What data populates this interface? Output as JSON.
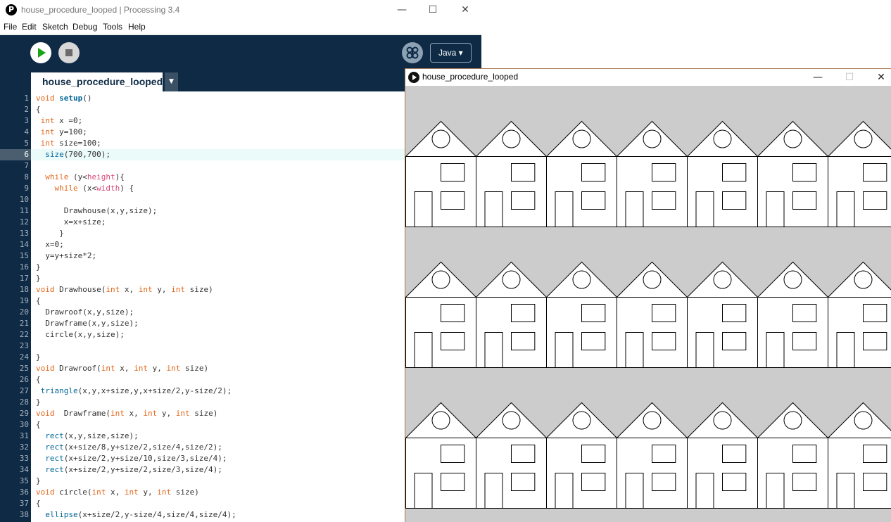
{
  "ide": {
    "window_title": "house_procedure_looped | Processing 3.4",
    "logo_glyph": "P",
    "window_controls": {
      "minimize": "—",
      "maximize": "☐",
      "close": "✕"
    },
    "menu": [
      "File",
      "Edit",
      "Sketch",
      "Debug",
      "Tools",
      "Help"
    ],
    "toolbar": {
      "run": "run-button",
      "stop": "stop-button",
      "debug": "debugger-button",
      "mode": "Java ▾"
    },
    "tab": {
      "name": "house_procedure_looped",
      "menu_arrow": "▼"
    },
    "current_line": 6,
    "line_numbers": [
      "1",
      "2",
      "3",
      "4",
      "5",
      "6",
      "7",
      "8",
      "9",
      "10",
      "11",
      "12",
      "13",
      "14",
      "15",
      "16",
      "17",
      "18",
      "19",
      "20",
      "21",
      "22",
      "23",
      "24",
      "25",
      "26",
      "27",
      "28",
      "29",
      "30",
      "31",
      "32",
      "33",
      "34",
      "35",
      "36",
      "37",
      "38"
    ],
    "code": [
      [
        [
          "kw",
          "void "
        ],
        [
          "kf",
          "setup"
        ],
        [
          "p",
          "()"
        ]
      ],
      [
        [
          "p",
          "{"
        ]
      ],
      [
        [
          "p",
          " "
        ],
        [
          "kw",
          "int"
        ],
        [
          "p",
          " x =0;"
        ]
      ],
      [
        [
          "p",
          " "
        ],
        [
          "kw",
          "int"
        ],
        [
          "p",
          " y=100;"
        ]
      ],
      [
        [
          "p",
          " "
        ],
        [
          "kw",
          "int"
        ],
        [
          "p",
          " size=100;"
        ]
      ],
      [
        [
          "p",
          "  "
        ],
        [
          "fn",
          "size"
        ],
        [
          "p",
          "(700,700);"
        ]
      ],
      [],
      [
        [
          "p",
          "  "
        ],
        [
          "kw",
          "while"
        ],
        [
          "p",
          " (y<"
        ],
        [
          "cv",
          "height"
        ],
        [
          "p",
          ")"
        ],
        [
          "p",
          "{"
        ]
      ],
      [
        [
          "p",
          "    "
        ],
        [
          "kw",
          "while"
        ],
        [
          "p",
          " (x<"
        ],
        [
          "cv",
          "width"
        ],
        [
          "p",
          ") {"
        ]
      ],
      [],
      [
        [
          "p",
          "      Drawhouse(x,y,size);"
        ]
      ],
      [
        [
          "p",
          "      x=x+size;"
        ]
      ],
      [
        [
          "p",
          "     }"
        ]
      ],
      [
        [
          "p",
          "  x=0;"
        ]
      ],
      [
        [
          "p",
          "  y=y+size*2;"
        ]
      ],
      [
        [
          "p",
          "}"
        ]
      ],
      [
        [
          "p",
          "}"
        ]
      ],
      [
        [
          "kw",
          "void"
        ],
        [
          "p",
          " Drawhouse("
        ],
        [
          "kw",
          "int"
        ],
        [
          "p",
          " x, "
        ],
        [
          "kw",
          "int"
        ],
        [
          "p",
          " y, "
        ],
        [
          "kw",
          "int"
        ],
        [
          "p",
          " size)"
        ]
      ],
      [
        [
          "p",
          "{"
        ]
      ],
      [
        [
          "p",
          "  Drawroof(x,y,size);"
        ]
      ],
      [
        [
          "p",
          "  Drawframe(x,y,size);"
        ]
      ],
      [
        [
          "p",
          "  circle(x,y,size);"
        ]
      ],
      [],
      [
        [
          "p",
          "}"
        ]
      ],
      [
        [
          "kw",
          "void"
        ],
        [
          "p",
          " Drawroof("
        ],
        [
          "kw",
          "int"
        ],
        [
          "p",
          " x, "
        ],
        [
          "kw",
          "int"
        ],
        [
          "p",
          " y, "
        ],
        [
          "kw",
          "int"
        ],
        [
          "p",
          " size)"
        ]
      ],
      [
        [
          "p",
          "{"
        ]
      ],
      [
        [
          "p",
          " "
        ],
        [
          "fn",
          "triangle"
        ],
        [
          "p",
          "(x,y,x+size,y,x+size/2,y-size/2);"
        ]
      ],
      [
        [
          "p",
          "}"
        ]
      ],
      [
        [
          "kw",
          "void"
        ],
        [
          "p",
          "  Drawframe("
        ],
        [
          "kw",
          "int"
        ],
        [
          "p",
          " x, "
        ],
        [
          "kw",
          "int"
        ],
        [
          "p",
          " y, "
        ],
        [
          "kw",
          "int"
        ],
        [
          "p",
          " size)"
        ]
      ],
      [
        [
          "p",
          "{"
        ]
      ],
      [
        [
          "p",
          "  "
        ],
        [
          "fn",
          "rect"
        ],
        [
          "p",
          "(x,y,size,size);"
        ]
      ],
      [
        [
          "p",
          "  "
        ],
        [
          "fn",
          "rect"
        ],
        [
          "p",
          "(x+size/8,y+size/2,size/4,size/2);"
        ]
      ],
      [
        [
          "p",
          "  "
        ],
        [
          "fn",
          "rect"
        ],
        [
          "p",
          "(x+size/2,y+size/10,size/3,size/4);"
        ]
      ],
      [
        [
          "p",
          "  "
        ],
        [
          "fn",
          "rect"
        ],
        [
          "p",
          "(x+size/2,y+size/2,size/3,size/4);"
        ]
      ],
      [
        [
          "p",
          "}"
        ]
      ],
      [
        [
          "kw",
          "void"
        ],
        [
          "p",
          " circle("
        ],
        [
          "kw",
          "int"
        ],
        [
          "p",
          " x, "
        ],
        [
          "kw",
          "int"
        ],
        [
          "p",
          " y, "
        ],
        [
          "kw",
          "int"
        ],
        [
          "p",
          " size)"
        ]
      ],
      [
        [
          "p",
          "{"
        ]
      ],
      [
        [
          "p",
          "  "
        ],
        [
          "fn",
          "ellipse"
        ],
        [
          "p",
          "(x+size/2,y-size/4,size/4,size/4);"
        ]
      ]
    ]
  },
  "sketch": {
    "window_title": "house_procedure_looped",
    "window_controls": {
      "minimize": "—",
      "maximize": "☐",
      "close": "✕"
    },
    "canvas": {
      "background": "#cccccc",
      "fill": "#ffffff",
      "stroke": "#000000"
    }
  },
  "colors": {
    "toolbar": "#0e2a45",
    "keyword": "#e2661a",
    "function": "#006699",
    "constant": "#d94a7a",
    "current_line": "#ebfbfa"
  }
}
